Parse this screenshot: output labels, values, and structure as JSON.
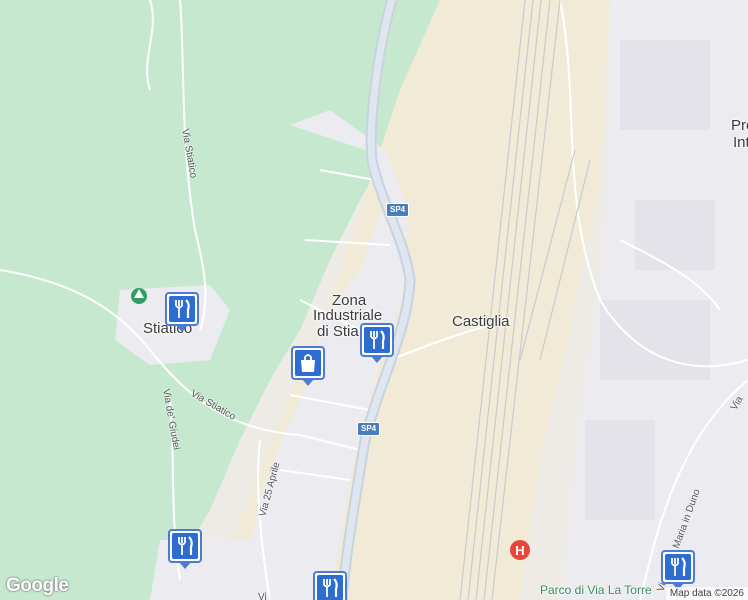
{
  "labels": {
    "zona_line1": "Zona",
    "zona_line2": "Industriale",
    "zona_line3": "di Stia",
    "castiglia": "Castiglia",
    "stiatico": "Stiatico",
    "pro_partial": "Pro",
    "int_partial": "Int",
    "via_stiatico_north": "Via Stiatico",
    "via_stiatico_south": "Via Stiatico",
    "via_de_giudei": "Via de' Giudei",
    "via_25_aprile": "Via 25 Aprile",
    "via_santa_maria": "Via Santa Maria in Duno",
    "via_partial_right": "Via",
    "via_partial_bottom": "Vi",
    "parco": "Parco di Via La Torre"
  },
  "road_shields": {
    "sp4_north": "SP4",
    "sp4_south": "SP4"
  },
  "markers": [
    {
      "kind": "restaurant",
      "icon": "fork-knife-icon"
    },
    {
      "kind": "restaurant",
      "icon": "fork-knife-icon"
    },
    {
      "kind": "shopping",
      "icon": "shopping-bag-icon"
    },
    {
      "kind": "restaurant",
      "icon": "fork-knife-icon"
    },
    {
      "kind": "restaurant",
      "icon": "fork-knife-icon"
    },
    {
      "kind": "restaurant",
      "icon": "fork-knife-icon"
    }
  ],
  "branding": {
    "logo": "Google",
    "attribution": "Map data ©2026"
  },
  "colors": {
    "green_area": "#c5e8cf",
    "urban": "#eeebe6",
    "sand": "#f1ead6",
    "marker": "#2d6cd1",
    "highway": "#c8d3e0"
  }
}
